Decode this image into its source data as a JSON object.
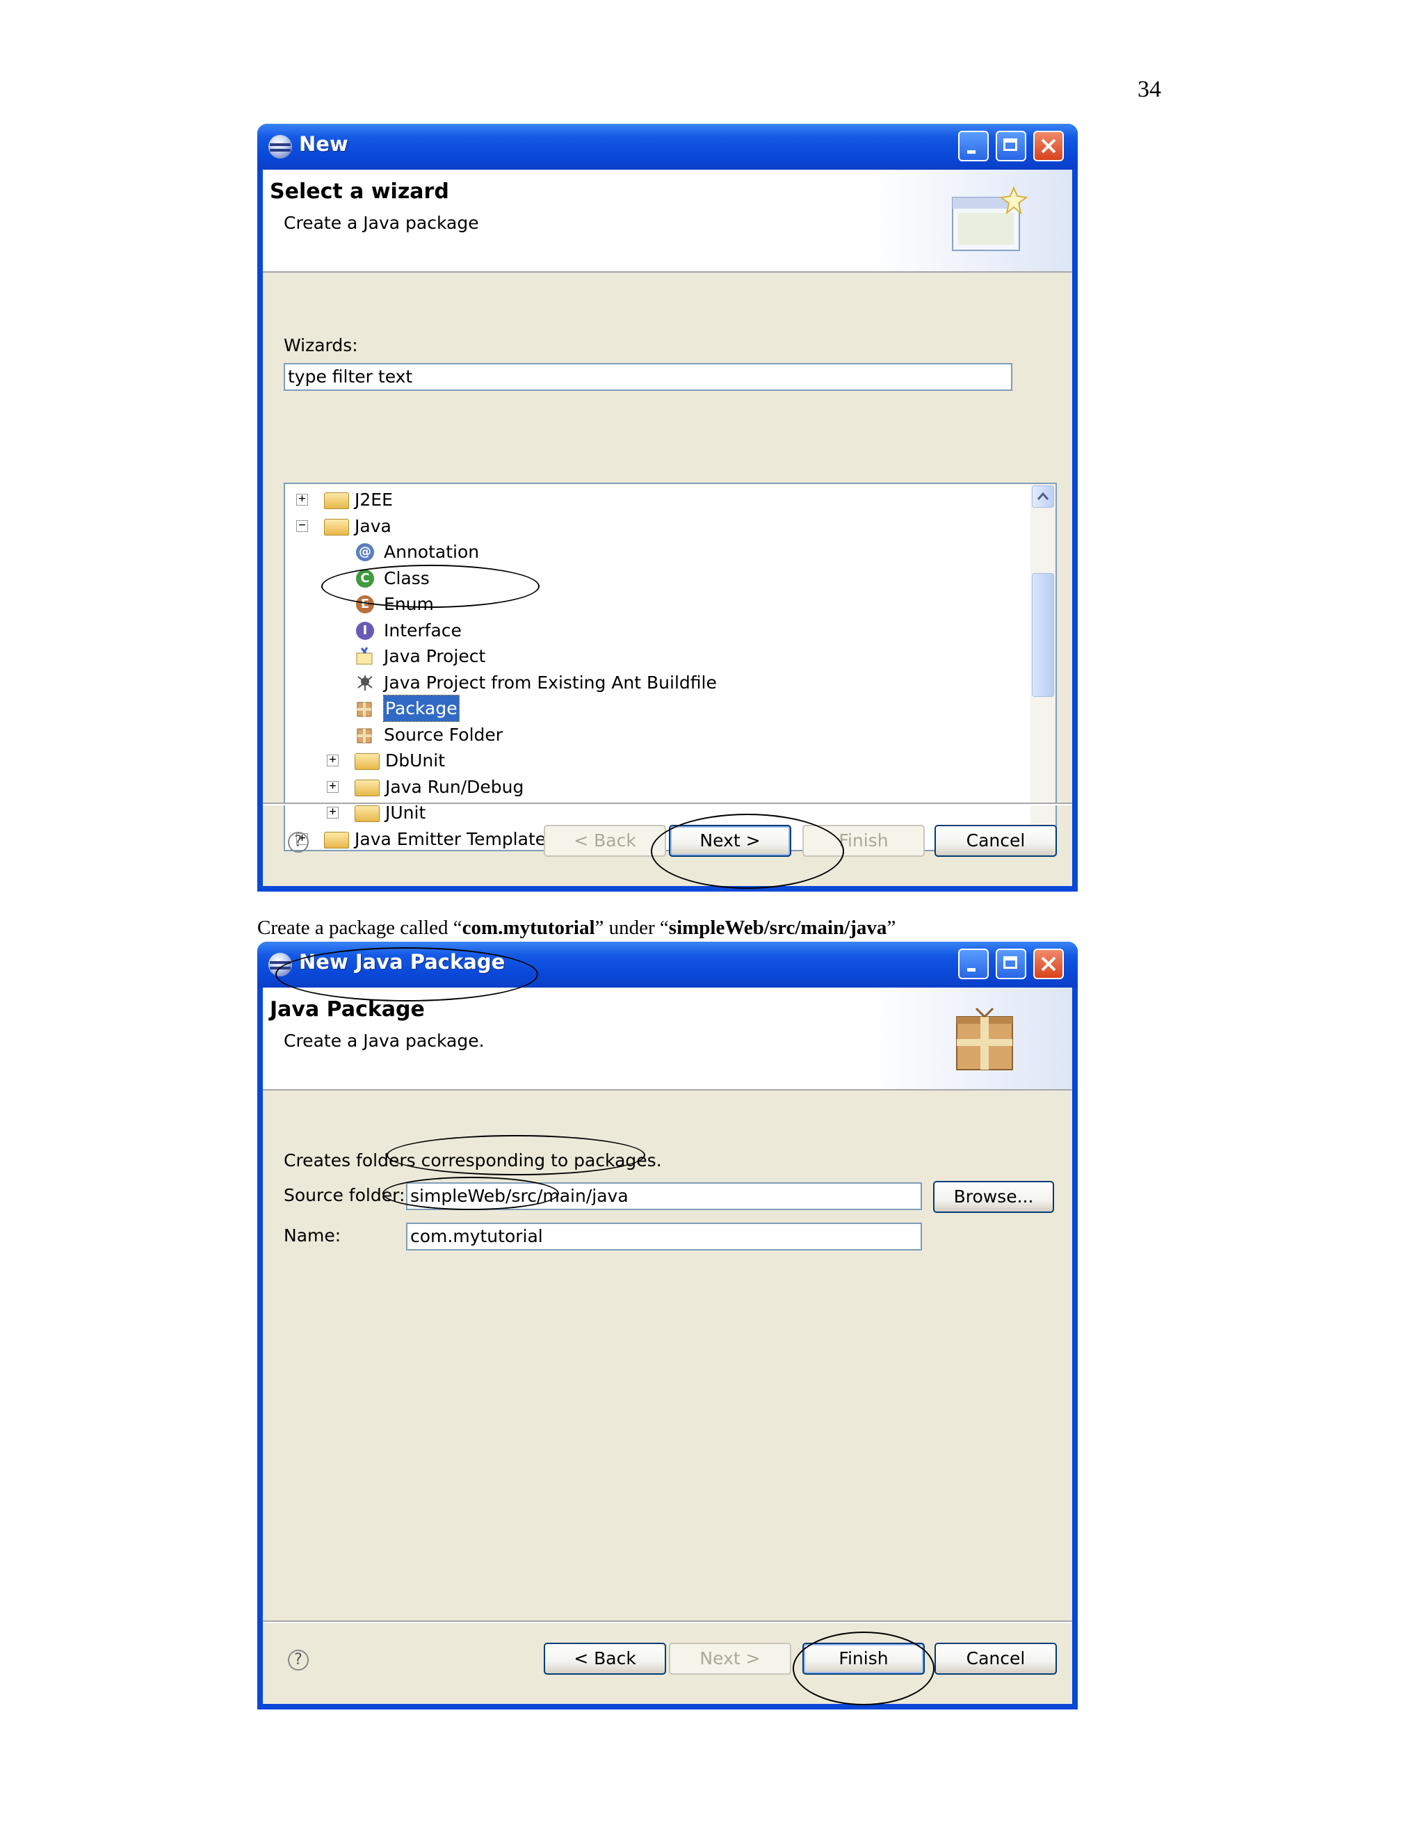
{
  "page": {
    "number": "34",
    "caption": {
      "p1": "Create a package called “",
      "b1": "com.mytutorial",
      "p2": "” under “",
      "b2": "simpleWeb/src/main/java",
      "p3": "”"
    }
  },
  "dialog1": {
    "title": "New",
    "banner_title": "Select a wizard",
    "banner_desc": "Create a Java package",
    "wizards_label": "Wizards:",
    "filter_value": "type filter text",
    "tree": [
      {
        "label": "J2EE",
        "icon": "folder-icon",
        "expander": "+"
      },
      {
        "label": "Java",
        "icon": "folder-icon",
        "expander": "-"
      },
      {
        "label": "Annotation",
        "icon": "annotation-icon"
      },
      {
        "label": "Class",
        "icon": "class-icon"
      },
      {
        "label": "Enum",
        "icon": "enum-icon"
      },
      {
        "label": "Interface",
        "icon": "interface-icon"
      },
      {
        "label": "Java Project",
        "icon": "java-project-icon"
      },
      {
        "label": "Java Project from Existing Ant Buildfile",
        "icon": "ant-icon"
      },
      {
        "label": "Package",
        "icon": "package-icon"
      },
      {
        "label": "Source Folder",
        "icon": "source-folder-icon"
      },
      {
        "label": "DbUnit",
        "icon": "folder-icon",
        "expander": "+"
      },
      {
        "label": "Java Run/Debug",
        "icon": "folder-icon",
        "expander": "+"
      },
      {
        "label": "JUnit",
        "icon": "folder-icon",
        "expander": "+"
      },
      {
        "label": "Java Emitter Templates",
        "icon": "folder-icon",
        "expander": "+"
      }
    ],
    "buttons": {
      "back": "< Back",
      "next": "Next >",
      "finish": "Finish",
      "cancel": "Cancel"
    }
  },
  "dialog2": {
    "title": "New Java Package",
    "banner_title": "Java Package",
    "banner_desc": "Create a Java package.",
    "info": "Creates folders corresponding to packages.",
    "source_folder_label": "Source folder:",
    "source_folder_value": "simpleWeb/src/main/java",
    "browse": "Browse...",
    "name_label": "Name:",
    "name_value": "com.mytutorial",
    "buttons": {
      "back": "< Back",
      "next": "Next >",
      "finish": "Finish",
      "cancel": "Cancel"
    }
  }
}
